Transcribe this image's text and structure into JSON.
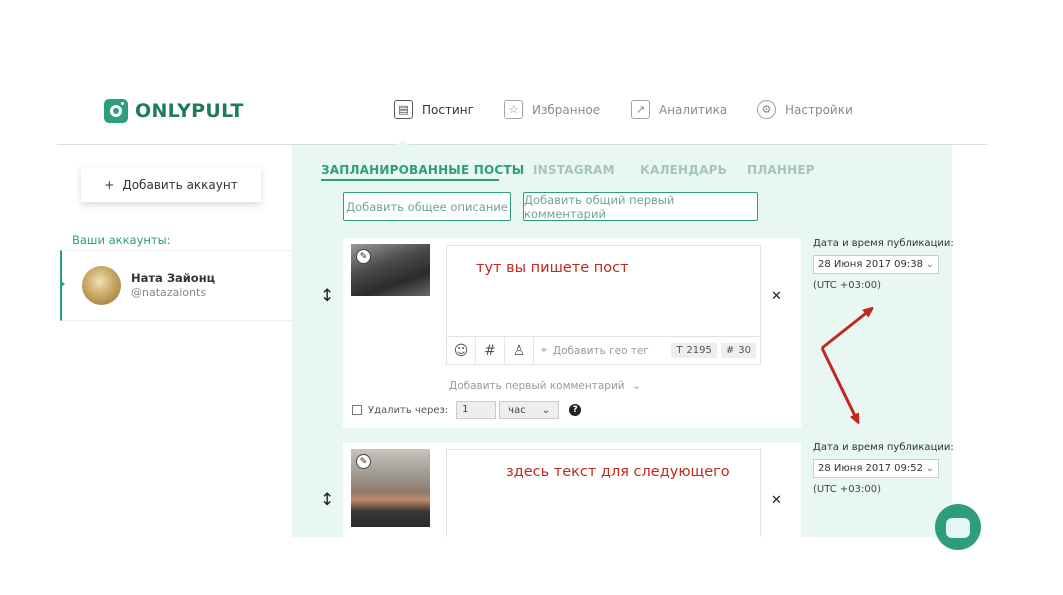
{
  "logo": {
    "text": "ONLYPULT"
  },
  "nav": [
    {
      "label": "Постинг",
      "icon": "posting-icon",
      "active": true
    },
    {
      "label": "Избранное",
      "icon": "star-icon",
      "active": false
    },
    {
      "label": "Аналитика",
      "icon": "chart-icon",
      "active": false
    },
    {
      "label": "Настройки",
      "icon": "gear-icon",
      "active": false
    }
  ],
  "sidebar": {
    "add_account_label": "Добавить аккаунт",
    "accounts_caption": "Ваши аккаунты:",
    "account": {
      "name": "Ната Зайонц",
      "handle": "@natazaionts"
    }
  },
  "tabs": [
    "ЗАПЛАНИРОВАННЫЕ ПОСТЫ",
    "INSTAGRAM",
    "КАЛЕНДАРЬ",
    "ПЛАННЕР"
  ],
  "actions": {
    "add_description": "Добавить общее описание",
    "add_first_comment": "Добавить общий первый комментарий"
  },
  "posts": [
    {
      "text": "тут вы пишете пост",
      "geo_placeholder": "Добавить гео тег",
      "char_count": "2195",
      "hashtag_count": "30",
      "first_comment_label": "Добавить первый комментарий",
      "delete_label": "Удалить через:",
      "delete_value": "1",
      "delete_unit": "час",
      "date_label": "Дата и время публикации:",
      "date_value": "28 Июня 2017 09:38",
      "timezone": "(UTC +03:00)"
    },
    {
      "text": "здесь текст для следующего",
      "date_label": "Дата и время публикации:",
      "date_value": "28 Июня 2017 09:52",
      "timezone": "(UTC +03:00)"
    }
  ],
  "colors": {
    "brand": "#2e9d7d",
    "panel_bg": "#e8f7f2",
    "annotation_red": "#c0291c"
  }
}
